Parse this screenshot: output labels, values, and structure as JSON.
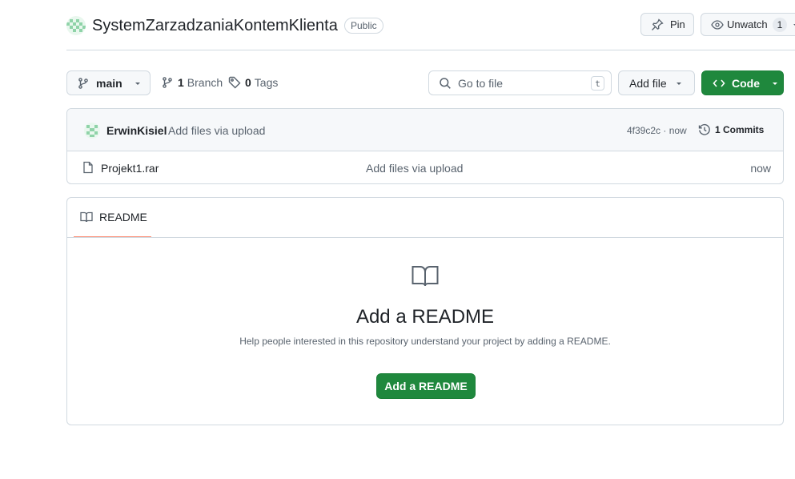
{
  "repo": {
    "name": "SystemZarzadzaniaKontemKlienta",
    "visibility": "Public",
    "pin_label": "Pin",
    "unwatch_label": "Unwatch",
    "watch_count": "1"
  },
  "toolbar": {
    "branch_name": "main",
    "branch_count": "1",
    "branch_label": "Branch",
    "tag_count": "0",
    "tag_label": "Tags",
    "search_placeholder": "Go to file",
    "search_shortcut": "t",
    "add_file_label": "Add file",
    "code_label": "Code"
  },
  "latest_commit": {
    "author": "ErwinKisiel",
    "message": "Add files via upload",
    "hash_time": "4f39c2c · now",
    "commits_label": "1 Commits"
  },
  "files": [
    {
      "name": "Projekt1.rar",
      "message": "Add files via upload",
      "time": "now"
    }
  ],
  "readme": {
    "tab_label": "README",
    "empty_title": "Add a README",
    "empty_description": "Help people interested in this repository understand your project by adding a README.",
    "add_button_label": "Add a README"
  },
  "colors": {
    "primary_green": "#1f883d",
    "tab_underline": "#fd8c73",
    "avatar_green": "#8fd3a8"
  },
  "icons": [
    "repo-avatar-icon",
    "pin-icon",
    "eye-icon",
    "git-branch-icon",
    "tag-icon",
    "search-icon",
    "code-icon",
    "history-icon",
    "file-icon",
    "book-icon",
    "caret-down-icon"
  ]
}
